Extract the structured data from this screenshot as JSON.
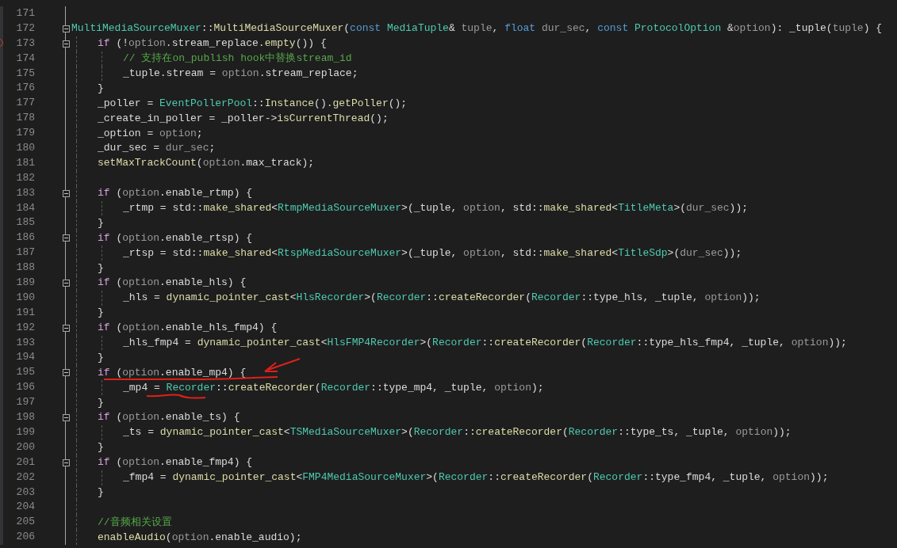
{
  "editor": {
    "lines": [
      {
        "number": "171"
      },
      {
        "number": "172",
        "fold": true,
        "tokens": [
          {
            "kind": "type",
            "text": "MultiMediaSourceMuxer"
          },
          {
            "kind": "text",
            "text": "::"
          },
          {
            "kind": "fn",
            "text": "MultiMediaSourceMuxer"
          },
          {
            "kind": "text",
            "text": "("
          },
          {
            "kind": "keyword",
            "text": "const "
          },
          {
            "kind": "type",
            "text": "MediaTuple"
          },
          {
            "kind": "text",
            "text": "& "
          },
          {
            "kind": "param",
            "text": "tuple"
          },
          {
            "kind": "text",
            "text": ", "
          },
          {
            "kind": "keyword",
            "text": "float "
          },
          {
            "kind": "param",
            "text": "dur_sec"
          },
          {
            "kind": "text",
            "text": ", "
          },
          {
            "kind": "keyword",
            "text": "const "
          },
          {
            "kind": "type",
            "text": "ProtocolOption"
          },
          {
            "kind": "text",
            "text": " &"
          },
          {
            "kind": "param",
            "text": "option"
          },
          {
            "kind": "text",
            "text": "): _tuple("
          },
          {
            "kind": "param",
            "text": "tuple"
          },
          {
            "kind": "text",
            "text": ") {"
          }
        ],
        "children": [
          {
            "number": "173",
            "fold": true,
            "breakpoint": true,
            "tokens": [
              {
                "kind": "control",
                "text": "if"
              },
              {
                "kind": "text",
                "text": " (!"
              },
              {
                "kind": "param",
                "text": "option"
              },
              {
                "kind": "text",
                "text": ".stream_replace."
              },
              {
                "kind": "fn",
                "text": "empty"
              },
              {
                "kind": "text",
                "text": "()) {"
              }
            ],
            "children": [
              {
                "number": "174",
                "tokens": [
                  {
                    "kind": "comment",
                    "text": "// 支持在on_publish hook中替换stream_id"
                  }
                ]
              },
              {
                "number": "175",
                "tokens": [
                  {
                    "kind": "text",
                    "text": "_tuple.stream = "
                  },
                  {
                    "kind": "param",
                    "text": "option"
                  },
                  {
                    "kind": "text",
                    "text": ".stream_replace;"
                  }
                ]
              }
            ]
          },
          {
            "number": "176",
            "tokens": [
              {
                "kind": "text",
                "text": "}"
              }
            ]
          },
          {
            "number": "177",
            "tokens": [
              {
                "kind": "text",
                "text": "_poller = "
              },
              {
                "kind": "type",
                "text": "EventPollerPool"
              },
              {
                "kind": "text",
                "text": "::"
              },
              {
                "kind": "fn",
                "text": "Instance"
              },
              {
                "kind": "text",
                "text": "()."
              },
              {
                "kind": "fn",
                "text": "getPoller"
              },
              {
                "kind": "text",
                "text": "();"
              }
            ]
          },
          {
            "number": "178",
            "tokens": [
              {
                "kind": "text",
                "text": "_create_in_poller = _poller->"
              },
              {
                "kind": "fn",
                "text": "isCurrentThread"
              },
              {
                "kind": "text",
                "text": "();"
              }
            ]
          },
          {
            "number": "179",
            "tokens": [
              {
                "kind": "text",
                "text": "_option = "
              },
              {
                "kind": "param",
                "text": "option"
              },
              {
                "kind": "text",
                "text": ";"
              }
            ]
          },
          {
            "number": "180",
            "tokens": [
              {
                "kind": "text",
                "text": "_dur_sec = "
              },
              {
                "kind": "param",
                "text": "dur_sec"
              },
              {
                "kind": "text",
                "text": ";"
              }
            ]
          },
          {
            "number": "181",
            "tokens": [
              {
                "kind": "fn",
                "text": "setMaxTrackCount"
              },
              {
                "kind": "text",
                "text": "("
              },
              {
                "kind": "param",
                "text": "option"
              },
              {
                "kind": "text",
                "text": ".max_track);"
              }
            ]
          },
          {
            "number": "182"
          },
          {
            "number": "183",
            "fold": true,
            "tokens": [
              {
                "kind": "control",
                "text": "if"
              },
              {
                "kind": "text",
                "text": " ("
              },
              {
                "kind": "param",
                "text": "option"
              },
              {
                "kind": "text",
                "text": ".enable_rtmp) {"
              }
            ],
            "children": [
              {
                "number": "184",
                "tokens": [
                  {
                    "kind": "text",
                    "text": "_rtmp = std::"
                  },
                  {
                    "kind": "fn",
                    "text": "make_shared"
                  },
                  {
                    "kind": "text",
                    "text": "<"
                  },
                  {
                    "kind": "type",
                    "text": "RtmpMediaSourceMuxer"
                  },
                  {
                    "kind": "text",
                    "text": ">(_tuple, "
                  },
                  {
                    "kind": "param",
                    "text": "option"
                  },
                  {
                    "kind": "text",
                    "text": ", std::"
                  },
                  {
                    "kind": "fn",
                    "text": "make_shared"
                  },
                  {
                    "kind": "text",
                    "text": "<"
                  },
                  {
                    "kind": "type",
                    "text": "TitleMeta"
                  },
                  {
                    "kind": "text",
                    "text": ">("
                  },
                  {
                    "kind": "param",
                    "text": "dur_sec"
                  },
                  {
                    "kind": "text",
                    "text": "));"
                  }
                ]
              }
            ]
          },
          {
            "number": "185",
            "tokens": [
              {
                "kind": "text",
                "text": "}"
              }
            ]
          },
          {
            "number": "186",
            "fold": true,
            "tokens": [
              {
                "kind": "control",
                "text": "if"
              },
              {
                "kind": "text",
                "text": " ("
              },
              {
                "kind": "param",
                "text": "option"
              },
              {
                "kind": "text",
                "text": ".enable_rtsp) {"
              }
            ],
            "children": [
              {
                "number": "187",
                "tokens": [
                  {
                    "kind": "text",
                    "text": "_rtsp = std::"
                  },
                  {
                    "kind": "fn",
                    "text": "make_shared"
                  },
                  {
                    "kind": "text",
                    "text": "<"
                  },
                  {
                    "kind": "type",
                    "text": "RtspMediaSourceMuxer"
                  },
                  {
                    "kind": "text",
                    "text": ">(_tuple, "
                  },
                  {
                    "kind": "param",
                    "text": "option"
                  },
                  {
                    "kind": "text",
                    "text": ", std::"
                  },
                  {
                    "kind": "fn",
                    "text": "make_shared"
                  },
                  {
                    "kind": "text",
                    "text": "<"
                  },
                  {
                    "kind": "type",
                    "text": "TitleSdp"
                  },
                  {
                    "kind": "text",
                    "text": ">("
                  },
                  {
                    "kind": "param",
                    "text": "dur_sec"
                  },
                  {
                    "kind": "text",
                    "text": "));"
                  }
                ]
              }
            ]
          },
          {
            "number": "188",
            "tokens": [
              {
                "kind": "text",
                "text": "}"
              }
            ]
          },
          {
            "number": "189",
            "fold": true,
            "tokens": [
              {
                "kind": "control",
                "text": "if"
              },
              {
                "kind": "text",
                "text": " ("
              },
              {
                "kind": "param",
                "text": "option"
              },
              {
                "kind": "text",
                "text": ".enable_hls) {"
              }
            ],
            "children": [
              {
                "number": "190",
                "tokens": [
                  {
                    "kind": "text",
                    "text": "_hls = "
                  },
                  {
                    "kind": "fn",
                    "text": "dynamic_pointer_cast"
                  },
                  {
                    "kind": "text",
                    "text": "<"
                  },
                  {
                    "kind": "type",
                    "text": "HlsRecorder"
                  },
                  {
                    "kind": "text",
                    "text": ">("
                  },
                  {
                    "kind": "type",
                    "text": "Recorder"
                  },
                  {
                    "kind": "text",
                    "text": "::"
                  },
                  {
                    "kind": "fn",
                    "text": "createRecorder"
                  },
                  {
                    "kind": "text",
                    "text": "("
                  },
                  {
                    "kind": "type",
                    "text": "Recorder"
                  },
                  {
                    "kind": "text",
                    "text": "::type_hls, _tuple, "
                  },
                  {
                    "kind": "param",
                    "text": "option"
                  },
                  {
                    "kind": "text",
                    "text": "));"
                  }
                ]
              }
            ]
          },
          {
            "number": "191",
            "tokens": [
              {
                "kind": "text",
                "text": "}"
              }
            ]
          },
          {
            "number": "192",
            "fold": true,
            "tokens": [
              {
                "kind": "control",
                "text": "if"
              },
              {
                "kind": "text",
                "text": " ("
              },
              {
                "kind": "param",
                "text": "option"
              },
              {
                "kind": "text",
                "text": ".enable_hls_fmp4) {"
              }
            ],
            "children": [
              {
                "number": "193",
                "tokens": [
                  {
                    "kind": "text",
                    "text": "_hls_fmp4 = "
                  },
                  {
                    "kind": "fn",
                    "text": "dynamic_pointer_cast"
                  },
                  {
                    "kind": "text",
                    "text": "<"
                  },
                  {
                    "kind": "type",
                    "text": "HlsFMP4Recorder"
                  },
                  {
                    "kind": "text",
                    "text": ">("
                  },
                  {
                    "kind": "type",
                    "text": "Recorder"
                  },
                  {
                    "kind": "text",
                    "text": "::"
                  },
                  {
                    "kind": "fn",
                    "text": "createRecorder"
                  },
                  {
                    "kind": "text",
                    "text": "("
                  },
                  {
                    "kind": "type",
                    "text": "Recorder"
                  },
                  {
                    "kind": "text",
                    "text": "::type_hls_fmp4, _tuple, "
                  },
                  {
                    "kind": "param",
                    "text": "option"
                  },
                  {
                    "kind": "text",
                    "text": "));"
                  }
                ]
              }
            ]
          },
          {
            "number": "194",
            "tokens": [
              {
                "kind": "text",
                "text": "}"
              }
            ]
          },
          {
            "number": "195",
            "fold": true,
            "arrow_marked": true,
            "tokens": [
              {
                "kind": "control",
                "text": "if"
              },
              {
                "kind": "text",
                "text": " ("
              },
              {
                "kind": "param",
                "text": "option"
              },
              {
                "kind": "text",
                "text": ".enable_mp4) {"
              }
            ],
            "children": [
              {
                "number": "196",
                "underlined": true,
                "tokens": [
                  {
                    "kind": "text",
                    "text": "_mp4 = "
                  },
                  {
                    "kind": "type",
                    "text": "Recorder"
                  },
                  {
                    "kind": "text",
                    "text": "::"
                  },
                  {
                    "kind": "fn",
                    "text": "createRecorder"
                  },
                  {
                    "kind": "text",
                    "text": "("
                  },
                  {
                    "kind": "type",
                    "text": "Recorder"
                  },
                  {
                    "kind": "text",
                    "text": "::type_mp4, _tuple, "
                  },
                  {
                    "kind": "param",
                    "text": "option"
                  },
                  {
                    "kind": "text",
                    "text": ");"
                  }
                ]
              }
            ]
          },
          {
            "number": "197",
            "tokens": [
              {
                "kind": "text",
                "text": "}"
              }
            ]
          },
          {
            "number": "198",
            "fold": true,
            "tokens": [
              {
                "kind": "control",
                "text": "if"
              },
              {
                "kind": "text",
                "text": " ("
              },
              {
                "kind": "param",
                "text": "option"
              },
              {
                "kind": "text",
                "text": ".enable_ts) {"
              }
            ],
            "children": [
              {
                "number": "199",
                "tokens": [
                  {
                    "kind": "text",
                    "text": "_ts = "
                  },
                  {
                    "kind": "fn",
                    "text": "dynamic_pointer_cast"
                  },
                  {
                    "kind": "text",
                    "text": "<"
                  },
                  {
                    "kind": "type",
                    "text": "TSMediaSourceMuxer"
                  },
                  {
                    "kind": "text",
                    "text": ">("
                  },
                  {
                    "kind": "type",
                    "text": "Recorder"
                  },
                  {
                    "kind": "text",
                    "text": "::"
                  },
                  {
                    "kind": "fn",
                    "text": "createRecorder"
                  },
                  {
                    "kind": "text",
                    "text": "("
                  },
                  {
                    "kind": "type",
                    "text": "Recorder"
                  },
                  {
                    "kind": "text",
                    "text": "::type_ts, _tuple, "
                  },
                  {
                    "kind": "param",
                    "text": "option"
                  },
                  {
                    "kind": "text",
                    "text": "));"
                  }
                ]
              }
            ]
          },
          {
            "number": "200",
            "tokens": [
              {
                "kind": "text",
                "text": "}"
              }
            ]
          },
          {
            "number": "201",
            "fold": true,
            "tokens": [
              {
                "kind": "control",
                "text": "if"
              },
              {
                "kind": "text",
                "text": " ("
              },
              {
                "kind": "param",
                "text": "option"
              },
              {
                "kind": "text",
                "text": ".enable_fmp4) {"
              }
            ],
            "children": [
              {
                "number": "202",
                "tokens": [
                  {
                    "kind": "text",
                    "text": "_fmp4 = "
                  },
                  {
                    "kind": "fn",
                    "text": "dynamic_pointer_cast"
                  },
                  {
                    "kind": "text",
                    "text": "<"
                  },
                  {
                    "kind": "type",
                    "text": "FMP4MediaSourceMuxer"
                  },
                  {
                    "kind": "text",
                    "text": ">("
                  },
                  {
                    "kind": "type",
                    "text": "Recorder"
                  },
                  {
                    "kind": "text",
                    "text": "::"
                  },
                  {
                    "kind": "fn",
                    "text": "createRecorder"
                  },
                  {
                    "kind": "text",
                    "text": "("
                  },
                  {
                    "kind": "type",
                    "text": "Recorder"
                  },
                  {
                    "kind": "text",
                    "text": "::type_fmp4, _tuple, "
                  },
                  {
                    "kind": "param",
                    "text": "option"
                  },
                  {
                    "kind": "text",
                    "text": "));"
                  }
                ]
              }
            ]
          },
          {
            "number": "203",
            "tokens": [
              {
                "kind": "text",
                "text": "}"
              }
            ]
          },
          {
            "number": "204"
          },
          {
            "number": "205",
            "tokens": [
              {
                "kind": "comment",
                "text": "//音频相关设置"
              }
            ]
          },
          {
            "number": "206",
            "tokens": [
              {
                "kind": "fn",
                "text": "enableAudio"
              },
              {
                "kind": "text",
                "text": "("
              },
              {
                "kind": "param",
                "text": "option"
              },
              {
                "kind": "text",
                "text": ".enable_audio);"
              }
            ]
          }
        ]
      }
    ]
  }
}
